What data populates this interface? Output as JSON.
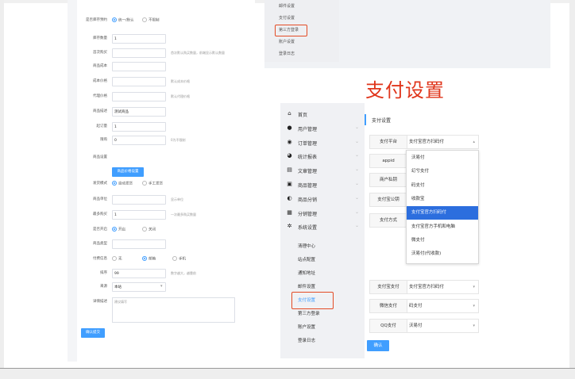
{
  "left_form": {
    "rows": [
      {
        "label": "是否库存预约",
        "type": "radio",
        "options": [
          "统一/默认",
          "不限制"
        ],
        "selected": 0
      },
      {
        "label": "库存数量",
        "type": "input",
        "value": "1"
      },
      {
        "label": "首次购买",
        "type": "input",
        "value": "",
        "hint": "首次默认购买数量，前端显示默认数量"
      },
      {
        "label": "商品成本",
        "type": "input",
        "value": ""
      },
      {
        "label": "成本价格",
        "type": "input",
        "value": "",
        "hint": "默认成本价格"
      },
      {
        "label": "代理价格",
        "type": "input",
        "value": "",
        "hint": "默认代理价格"
      },
      {
        "label": "商品描述",
        "type": "input",
        "value": "测试商品"
      },
      {
        "label": "起订量",
        "type": "input",
        "value": "1"
      },
      {
        "label": "限购",
        "type": "input",
        "value": "0",
        "hint": "0为不限制"
      },
      {
        "label": "商品设置",
        "type": "button",
        "value": "商品价格设置"
      },
      {
        "label": "发货模式",
        "type": "radio",
        "options": [
          "自动发货",
          "手工发货"
        ],
        "selected": 0
      },
      {
        "label": "商品单位",
        "type": "input",
        "value": "",
        "hint": "显示单位"
      },
      {
        "label": "最多购买",
        "type": "input",
        "value": "1",
        "hint": "一次最多购买数量"
      },
      {
        "label": "是否开启",
        "type": "radio",
        "options": [
          "开启",
          "关闭"
        ],
        "selected": 0
      },
      {
        "label": "商品类型",
        "type": "input",
        "value": ""
      },
      {
        "label": "付费信息",
        "type": "radio",
        "options": [
          "无",
          "邮箱",
          "手机"
        ],
        "selected": 1
      },
      {
        "label": "排序",
        "type": "input",
        "value": "99",
        "hint": "数字越大，越靠前"
      },
      {
        "label": "来源",
        "type": "select",
        "value": "本站"
      },
      {
        "label": "详情描述",
        "type": "textarea",
        "value": "建议填写"
      }
    ],
    "submit_label": "确认提交"
  },
  "top_menu": {
    "items": [
      "邮件设置",
      "支付设置",
      "第三方登录",
      "账户设置",
      "登录日志"
    ],
    "highlighted_index": 2
  },
  "title": "支付设置",
  "sidebar": {
    "items": [
      {
        "label": "首页",
        "icon": "home-icon",
        "glyph": "⌂"
      },
      {
        "label": "用户管理",
        "icon": "user-icon",
        "glyph": "●"
      },
      {
        "label": "订单管理",
        "icon": "order-icon",
        "glyph": "◉"
      },
      {
        "label": "统计报表",
        "icon": "chart-icon",
        "glyph": "◕"
      },
      {
        "label": "文章管理",
        "icon": "article-icon",
        "glyph": "▤"
      },
      {
        "label": "商品管理",
        "icon": "goods-icon",
        "glyph": "▣"
      },
      {
        "label": "商品分销",
        "icon": "share-icon",
        "glyph": "◐"
      },
      {
        "label": "分销管理",
        "icon": "grid-icon",
        "glyph": "▦"
      },
      {
        "label": "系统设置",
        "icon": "gear-icon",
        "glyph": "✲"
      }
    ],
    "sub_items": [
      "清理中心",
      "站点配置",
      "通知地址",
      "邮件设置",
      "支付设置",
      "第三方登录",
      "账户设置",
      "登录日志"
    ],
    "active_sub_index": 4
  },
  "page_title": "支付设置",
  "pay_rows": [
    {
      "label": "支付平台",
      "value": "支付宝官方扫码付"
    },
    {
      "label": "appid",
      "value": ""
    },
    {
      "label": "商户私钥",
      "value": ""
    },
    {
      "label": "支付宝公钥",
      "value": ""
    },
    {
      "label": "支付方式",
      "value": ""
    }
  ],
  "dropdown_options": [
    "沃易付",
    "幻兮支付",
    "码支付",
    "收款宝",
    "支付宝官方扫码付",
    "支付宝官方手机和电脑",
    "微支付",
    "沃易付(代收款)"
  ],
  "dropdown_selected": 4,
  "lower_rows": [
    {
      "label": "支付宝支付",
      "value": "支付宝官方扫码付"
    },
    {
      "label": "微信支付",
      "value": "码支付"
    },
    {
      "label": "QQ支付",
      "value": "沃易付"
    }
  ],
  "confirm_label": "确认",
  "colors": {
    "accent": "#409eff",
    "highlight": "#e34b25",
    "title_red": "#e0351b",
    "selected_blue": "#2c6ede"
  }
}
